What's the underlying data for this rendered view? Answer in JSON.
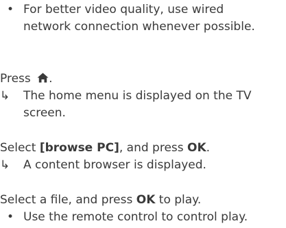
{
  "bullet_marker": "•",
  "result_marker": "↳",
  "tip": {
    "text": "For better video quality, use wired network connection whenever possible."
  },
  "step_press": {
    "prefix": "Press ",
    "suffix": ".",
    "icon": "home-icon"
  },
  "result_home": {
    "text": "The home menu is displayed on the TV screen."
  },
  "step_select_browse": {
    "prefix": "Select ",
    "item": "[browse PC]",
    "middle": ", and press ",
    "button": "OK",
    "suffix": "."
  },
  "result_browser": {
    "text": "A content browser is displayed."
  },
  "step_select_file": {
    "prefix": "Select a file, and press ",
    "button": "OK",
    "suffix": " to play."
  },
  "tip_remote": {
    "text": "Use the remote control to control play."
  }
}
